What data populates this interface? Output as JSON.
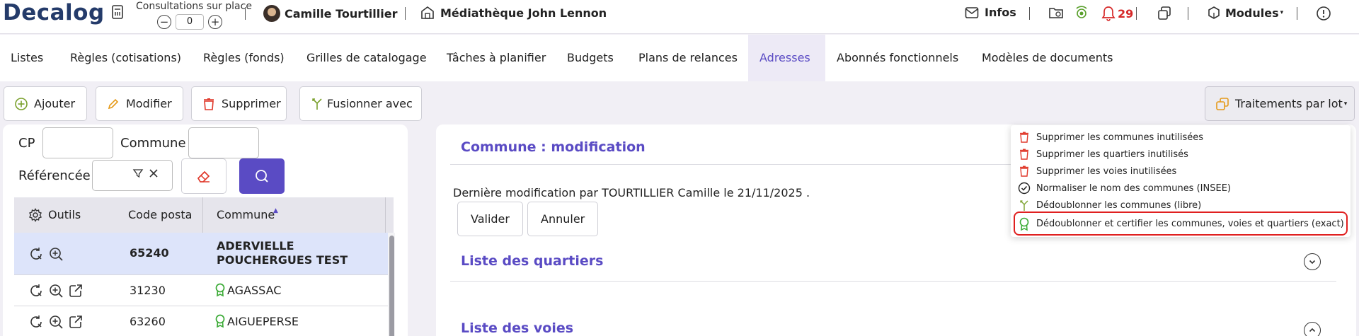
{
  "header": {
    "logo": "Decalog",
    "consultations_label": "Consultations sur place",
    "consultations_count": "0",
    "user_name": "Camille Tourtillier",
    "library_name": "Médiathèque John Lennon",
    "infos_label": "Infos",
    "notifications_count": "29",
    "modules_label": "Modules"
  },
  "tabs": [
    {
      "label": "Listes"
    },
    {
      "label": "Règles (cotisations)"
    },
    {
      "label": "Règles (fonds)"
    },
    {
      "label": "Grilles de catalogage"
    },
    {
      "label": "Tâches à planifier"
    },
    {
      "label": "Budgets"
    },
    {
      "label": "Plans de relances"
    },
    {
      "label": "Adresses"
    },
    {
      "label": "Abonnés fonctionnels"
    },
    {
      "label": "Modèles de documents"
    }
  ],
  "active_tab": "Adresses",
  "toolbar": {
    "add_label": "Ajouter",
    "edit_label": "Modifier",
    "delete_label": "Supprimer",
    "merge_label": "Fusionner avec",
    "batch_label": "Traitements par lot"
  },
  "filters": {
    "cp_label": "CP",
    "cp_value": "",
    "commune_label": "Commune",
    "commune_value": "",
    "referenced_label": "Référencée",
    "referenced_value": ""
  },
  "grid": {
    "columns": [
      "Outils",
      "Code posta",
      "Commune"
    ],
    "sort_indicator": "ascending",
    "rows": [
      {
        "code": "65240",
        "commune": "ADERVIELLE POUCHERGUES TEST",
        "selected": true,
        "certified": false
      },
      {
        "code": "31230",
        "commune": "AGASSAC",
        "selected": false,
        "certified": true
      },
      {
        "code": "63260",
        "commune": "AIGUEPERSE",
        "selected": false,
        "certified": true
      }
    ]
  },
  "detail": {
    "title": "Commune : modification",
    "last_modified": "Dernière modification par TOURTILLIER Camille le 21/11/2025 .",
    "validate_label": "Valider",
    "cancel_label": "Annuler",
    "quarters_title": "Liste des quartiers",
    "streets_title": "Liste des voies"
  },
  "batch_menu": {
    "items": [
      {
        "label": "Supprimer les communes inutilisées",
        "icon": "trash-icon"
      },
      {
        "label": "Supprimer les quartiers inutilisés",
        "icon": "trash-icon"
      },
      {
        "label": "Supprimer les voies inutilisées",
        "icon": "trash-icon"
      },
      {
        "label": "Normaliser le nom des communes (INSEE)",
        "icon": "check-badge-icon"
      },
      {
        "label": "Dédoublonner les communes (libre)",
        "icon": "merge-icon"
      },
      {
        "label": "Dédoublonner et certifier les communes, voies et quartiers (exact)",
        "icon": "certified-icon"
      }
    ],
    "highlighted_item": "Dédoublonner et certifier les communes, voies et quartiers (exact)"
  },
  "colors": {
    "accent": "#5a4bc4",
    "danger": "#d62828",
    "certified": "#3aaa35",
    "selected_row": "#dde4fa"
  }
}
